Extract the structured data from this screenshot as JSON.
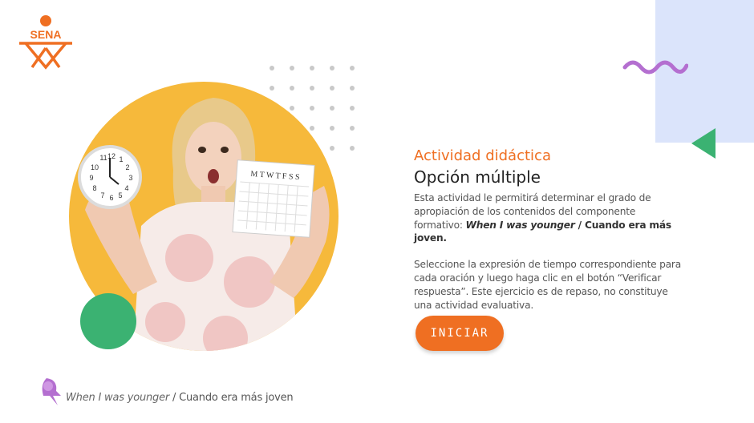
{
  "brand": {
    "logo_text": "SENA",
    "color": "#ef6f22"
  },
  "decor": {
    "accent_blue": "#dbe4fb",
    "accent_purple": "#b46fd0",
    "accent_green": "#3bb272",
    "photo_bg": "#f6b93b"
  },
  "hero": {
    "photo_alt": "woman-holding-clock-and-calendar",
    "clock_numbers": [
      "11",
      "12",
      "1",
      "10",
      "2",
      "9",
      "3",
      "8",
      "4",
      "7",
      "6",
      "5"
    ],
    "calendar_header": "M T W T F S S"
  },
  "content": {
    "kicker": "Actividad didáctica",
    "title": "Opción múltiple",
    "para1_prefix": "Esta actividad le permitirá determinar el grado de apropiación de los contenidos del componente formativo: ",
    "para1_em": "When I was younger",
    "para1_bold": " / Cuando era más joven.",
    "para2": "Seleccione la expresión de tiempo correspondiente para cada oración y luego haga clic en el botón “Verificar respuesta”.  Este ejercicio es de repaso, no constituye una actividad evaluativa."
  },
  "button": {
    "label": "INICIAR"
  },
  "footer": {
    "em": "When I was younger",
    "rest": " / Cuando era más joven"
  }
}
